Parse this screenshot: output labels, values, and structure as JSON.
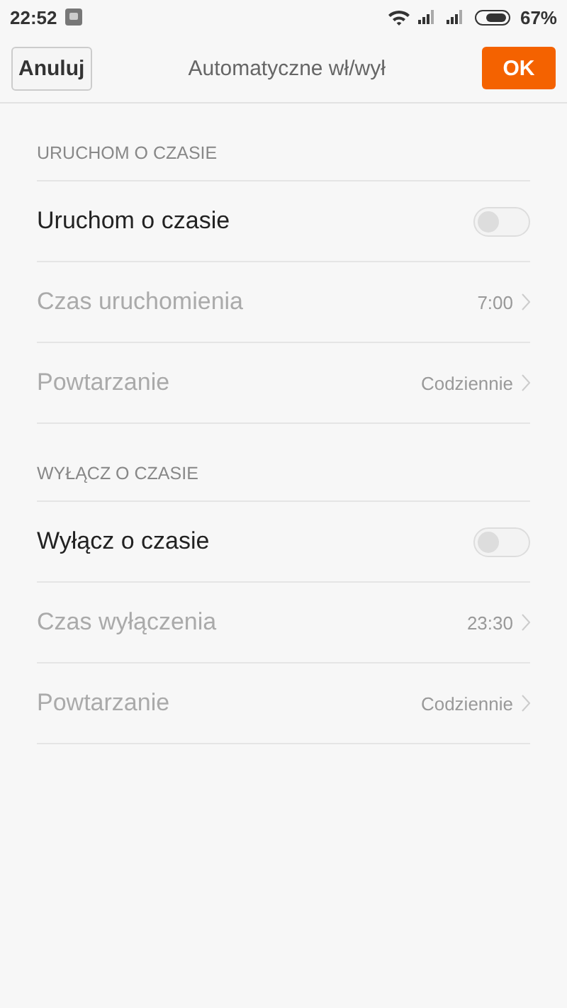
{
  "status_bar": {
    "time": "22:52",
    "battery_text": "67%"
  },
  "header": {
    "cancel": "Anuluj",
    "title": "Automatyczne wł/wył",
    "ok": "OK"
  },
  "sections": [
    {
      "title": "URUCHOM O CZASIE",
      "rows": [
        {
          "kind": "toggle",
          "label": "Uruchom o czasie",
          "on": false,
          "disabled": false
        },
        {
          "kind": "value",
          "label": "Czas uruchomienia",
          "value": "7:00",
          "disabled": true
        },
        {
          "kind": "value",
          "label": "Powtarzanie",
          "value": "Codziennie",
          "disabled": true
        }
      ]
    },
    {
      "title": "WYŁĄCZ O CZASIE",
      "rows": [
        {
          "kind": "toggle",
          "label": "Wyłącz o czasie",
          "on": false,
          "disabled": false
        },
        {
          "kind": "value",
          "label": "Czas wyłączenia",
          "value": "23:30",
          "disabled": true
        },
        {
          "kind": "value",
          "label": "Powtarzanie",
          "value": "Codziennie",
          "disabled": true
        }
      ]
    }
  ]
}
